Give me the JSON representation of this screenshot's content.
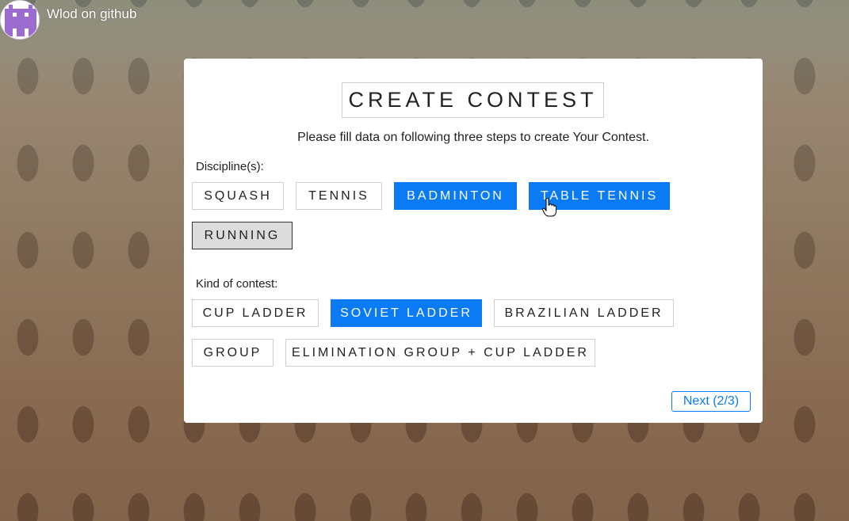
{
  "header": {
    "github_link": "Wlod on github",
    "avatar_icon": "pixel-avatar-icon"
  },
  "card": {
    "title": "CREATE CONTEST",
    "subtitle": "Please fill data on following three steps to create Your Contest.",
    "disciplines_label": "Discipline(s):",
    "disciplines": [
      {
        "label": "SQUASH",
        "state": "default"
      },
      {
        "label": "TENNIS",
        "state": "default"
      },
      {
        "label": "BADMINTON",
        "state": "selected"
      },
      {
        "label": "TABLE TENNIS",
        "state": "selected"
      },
      {
        "label": "RUNNING",
        "state": "pressed"
      }
    ],
    "kind_label": "Kind of contest:",
    "kinds": [
      {
        "label": "CUP LADDER",
        "state": "default"
      },
      {
        "label": "SOVIET LADDER",
        "state": "selected"
      },
      {
        "label": "BRAZILIAN LADDER",
        "state": "default"
      },
      {
        "label": "GROUP",
        "state": "default"
      },
      {
        "label": "ELIMINATION GROUP + CUP LADDER",
        "state": "default"
      }
    ],
    "next_button": "Next (2/3)"
  },
  "colors": {
    "accent": "#0a7bf5",
    "pressed": "#dcdcdc"
  }
}
